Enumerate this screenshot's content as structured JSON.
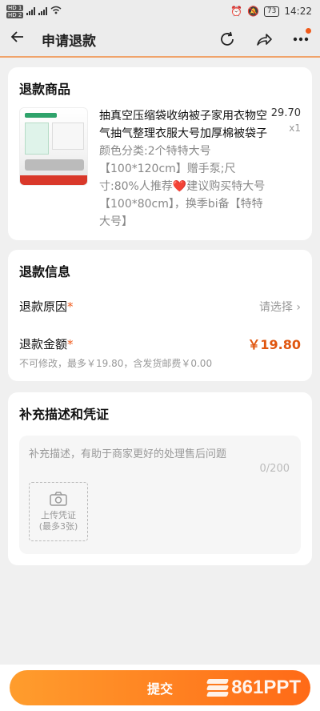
{
  "status_bar": {
    "sim1": "HD 1",
    "sim2": "HD 2",
    "battery": "73",
    "time": "14:22"
  },
  "header": {
    "title": "申请退款",
    "icons": [
      "back-arrow-icon",
      "refresh-icon",
      "share-icon",
      "more-icon"
    ]
  },
  "refund_goods": {
    "section_title": "退款商品",
    "product": {
      "name": "抽真空压缩袋收纳被子家用衣物空气抽气整理衣服大号加厚棉被袋子",
      "spec": "颜色分类:2个特特大号【100*120cm】赠手泵;尺寸:80%人推荐❤️建议购买特大号【100*80cm】，换季bi备【特特大号】",
      "price": "29.70",
      "qty": "x1"
    }
  },
  "refund_info": {
    "section_title": "退款信息",
    "reason_label": "退款原因",
    "reason_value": "请选择",
    "amount_label": "退款金额",
    "amount_value": "￥19.80",
    "amount_note": "不可修改，最多￥19.80，含发货邮费￥0.00"
  },
  "supplement": {
    "section_title": "补充描述和凭证",
    "placeholder": "补充描述，有助于商家更好的处理售后问题",
    "counter": "0/200",
    "upload_line1": "上传凭证",
    "upload_line2": "(最多3张)"
  },
  "bottom": {
    "submit_label": "提交",
    "watermark": "861PPT"
  },
  "colors": {
    "accent": "#e0560f",
    "button_start": "#ff9d2d",
    "button_end": "#ff6a17"
  }
}
